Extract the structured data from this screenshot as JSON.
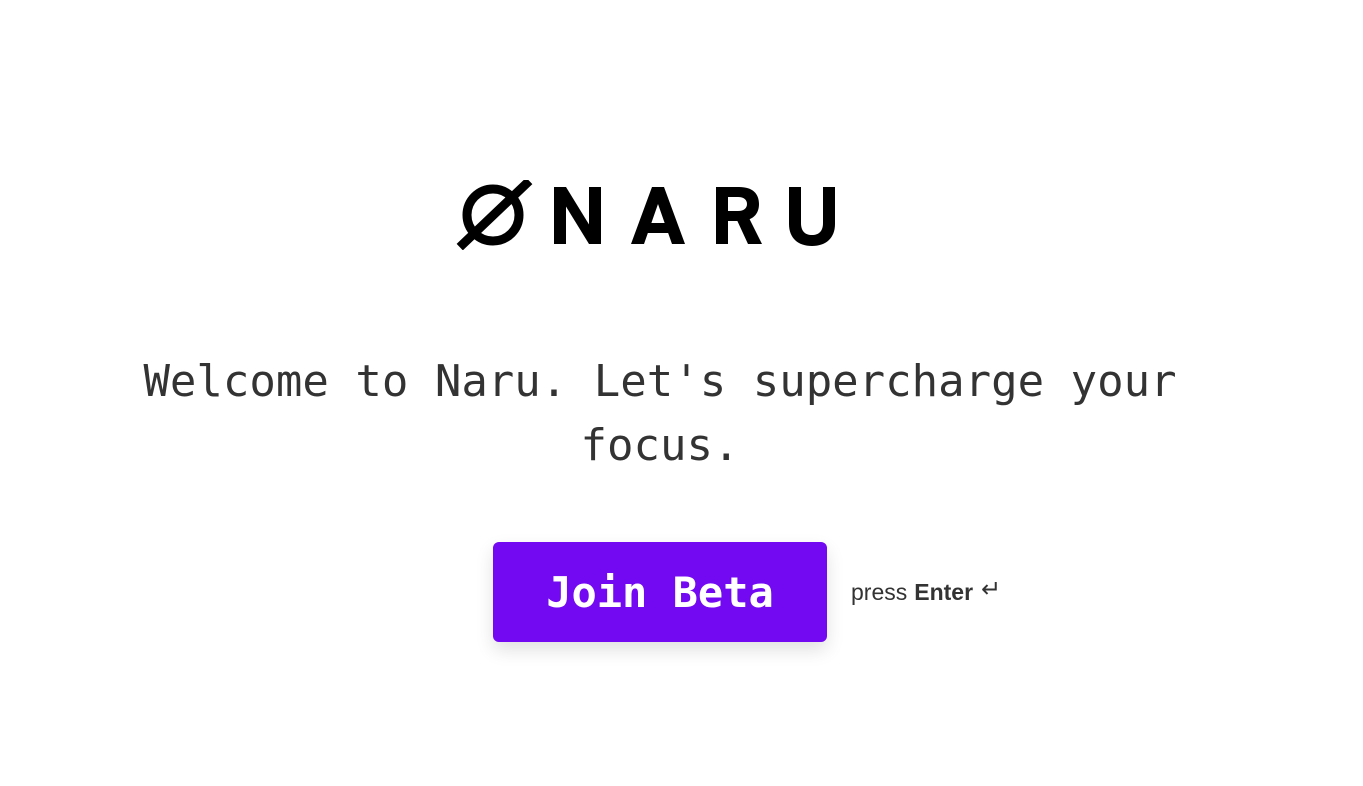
{
  "brand": {
    "logo_text": "ØNARU"
  },
  "welcome": {
    "message": "Welcome to Naru. Let's supercharge your focus."
  },
  "cta": {
    "button_label": "Join Beta",
    "hint_prefix": "press",
    "hint_key": "Enter",
    "hint_icon": "return-key-icon",
    "hint_glyph": "↵"
  },
  "colors": {
    "button_bg": "#7209f2",
    "text": "#333333",
    "logo": "#000000",
    "background": "#ffffff"
  }
}
